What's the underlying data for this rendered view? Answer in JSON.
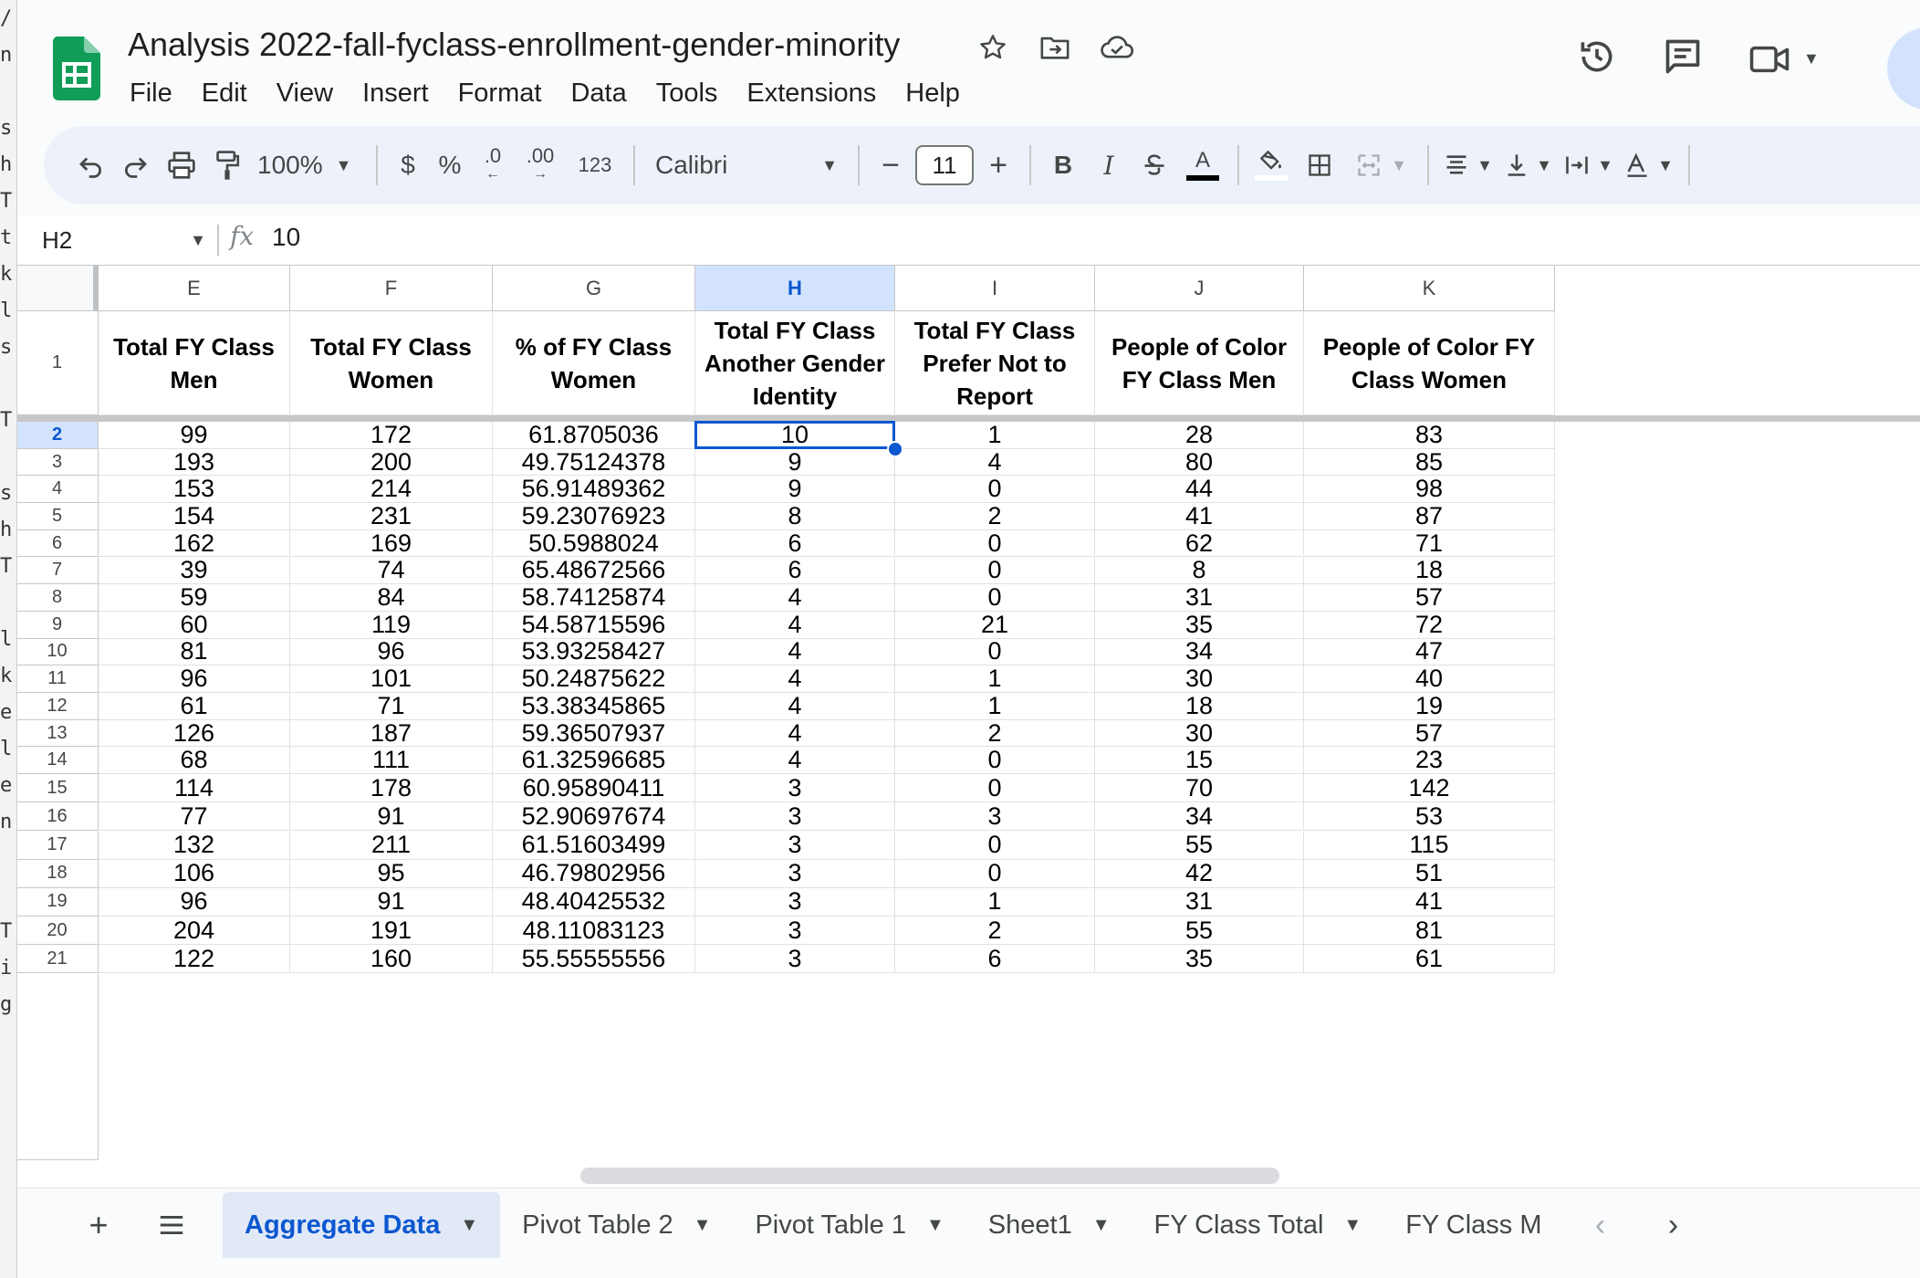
{
  "doc": {
    "title": "Analysis 2022-fall-fyclass-enrollment-gender-minority"
  },
  "menu": [
    "File",
    "Edit",
    "View",
    "Insert",
    "Format",
    "Data",
    "Tools",
    "Extensions",
    "Help"
  ],
  "toolbar": {
    "zoom": "100%",
    "currency": "$",
    "percent": "%",
    "decrease_decimal": ".0",
    "increase_decimal": ".00",
    "number_format": "123",
    "font": "Calibri",
    "font_size": "11",
    "minus": "−",
    "plus": "+",
    "bold": "B",
    "italic": "I",
    "text_color_letter": "A"
  },
  "formula": {
    "cell": "H2",
    "fx": "fx",
    "value": "10"
  },
  "columns": [
    "E",
    "F",
    "G",
    "H",
    "I",
    "J",
    "K"
  ],
  "selected_column": "H",
  "header_row": {
    "row": "1",
    "cells": [
      "Total FY Class Men",
      "Total FY Class Women",
      "% of FY Class Women",
      "Total FY Class Another Gender Identity",
      "Total FY Class Prefer Not to Report",
      "People of Color FY Class Men",
      "People of Color FY Class Women"
    ]
  },
  "rows": [
    {
      "n": "2",
      "c": [
        "99",
        "172",
        "61.8705036",
        "10",
        "1",
        "28",
        "83"
      ]
    },
    {
      "n": "3",
      "c": [
        "193",
        "200",
        "49.75124378",
        "9",
        "4",
        "80",
        "85"
      ]
    },
    {
      "n": "4",
      "c": [
        "153",
        "214",
        "56.91489362",
        "9",
        "0",
        "44",
        "98"
      ]
    },
    {
      "n": "5",
      "c": [
        "154",
        "231",
        "59.23076923",
        "8",
        "2",
        "41",
        "87"
      ]
    },
    {
      "n": "6",
      "c": [
        "162",
        "169",
        "50.5988024",
        "6",
        "0",
        "62",
        "71"
      ]
    },
    {
      "n": "7",
      "c": [
        "39",
        "74",
        "65.48672566",
        "6",
        "0",
        "8",
        "18"
      ]
    },
    {
      "n": "8",
      "c": [
        "59",
        "84",
        "58.74125874",
        "4",
        "0",
        "31",
        "57"
      ]
    },
    {
      "n": "9",
      "c": [
        "60",
        "119",
        "54.58715596",
        "4",
        "21",
        "35",
        "72"
      ]
    },
    {
      "n": "10",
      "c": [
        "81",
        "96",
        "53.93258427",
        "4",
        "0",
        "34",
        "47"
      ]
    },
    {
      "n": "11",
      "c": [
        "96",
        "101",
        "50.24875622",
        "4",
        "1",
        "30",
        "40"
      ]
    },
    {
      "n": "12",
      "c": [
        "61",
        "71",
        "53.38345865",
        "4",
        "1",
        "18",
        "19"
      ]
    },
    {
      "n": "13",
      "c": [
        "126",
        "187",
        "59.36507937",
        "4",
        "2",
        "30",
        "57"
      ]
    },
    {
      "n": "14",
      "c": [
        "68",
        "111",
        "61.32596685",
        "4",
        "0",
        "15",
        "23"
      ]
    },
    {
      "n": "15",
      "c": [
        "114",
        "178",
        "60.95890411",
        "3",
        "0",
        "70",
        "142"
      ]
    },
    {
      "n": "16",
      "c": [
        "77",
        "91",
        "52.90697674",
        "3",
        "3",
        "34",
        "53"
      ]
    },
    {
      "n": "17",
      "c": [
        "132",
        "211",
        "61.51603499",
        "3",
        "0",
        "55",
        "115"
      ]
    },
    {
      "n": "18",
      "c": [
        "106",
        "95",
        "46.79802956",
        "3",
        "0",
        "42",
        "51"
      ]
    },
    {
      "n": "19",
      "c": [
        "96",
        "91",
        "48.40425532",
        "3",
        "1",
        "31",
        "41"
      ]
    },
    {
      "n": "20",
      "c": [
        "204",
        "191",
        "48.11083123",
        "3",
        "2",
        "55",
        "81"
      ]
    },
    {
      "n": "21",
      "c": [
        "122",
        "160",
        "55.55555556",
        "3",
        "6",
        "35",
        "61"
      ]
    }
  ],
  "selected_row": "2",
  "sheets": [
    {
      "name": "Aggregate Data",
      "active": true
    },
    {
      "name": "Pivot Table 2",
      "active": false
    },
    {
      "name": "Pivot Table 1",
      "active": false
    },
    {
      "name": "Sheet1",
      "active": false
    },
    {
      "name": "FY Class Total",
      "active": false
    },
    {
      "name": "FY Class M",
      "active": false
    }
  ],
  "left_strip_chars": [
    "/",
    "n",
    "",
    "s",
    "h",
    "T",
    "t",
    "k",
    "l",
    "s",
    "",
    "T",
    "",
    "s",
    "h",
    "T",
    "",
    "l",
    "k",
    "e",
    "l",
    "e",
    "n",
    "",
    "",
    "T",
    "i",
    "g"
  ],
  "colors": {
    "accent": "#0b57d0",
    "selection_bg": "#d3e3fd",
    "sheets_green": "#0f9d58"
  }
}
